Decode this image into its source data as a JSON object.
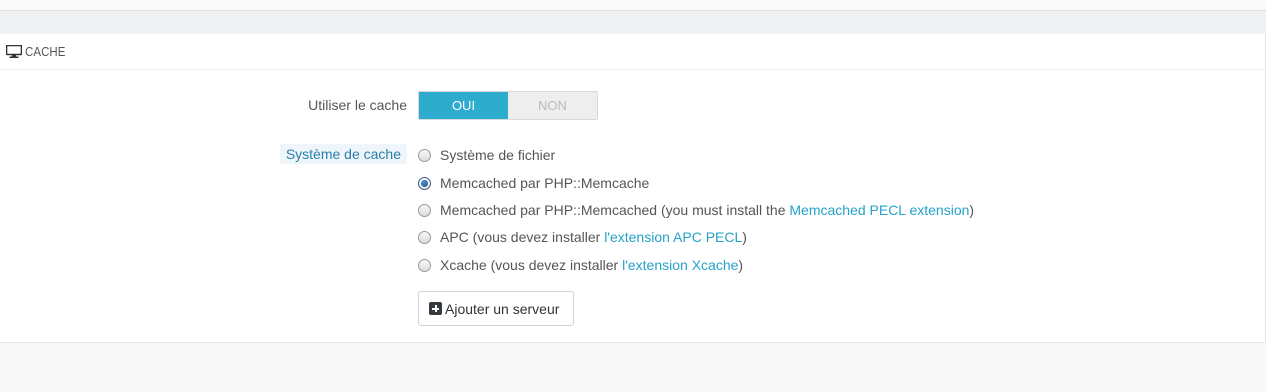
{
  "section": {
    "title": "CACHE",
    "icon": "desktop-icon"
  },
  "use_cache": {
    "label": "Utiliser le cache",
    "yes_label": "OUI",
    "no_label": "NON",
    "selected": "OUI"
  },
  "cache_system": {
    "label": "Système de cache",
    "options": [
      {
        "text": "Système de fichier",
        "checked": false
      },
      {
        "text": "Memcached par PHP::Memcache",
        "checked": true
      },
      {
        "text": "Memcached par PHP::Memcached (you must install the ",
        "link": "Memcached PECL extension",
        "suffix": ")",
        "checked": false
      },
      {
        "text": "APC (vous devez installer ",
        "link": "l'extension APC PECL",
        "suffix": ")",
        "checked": false
      },
      {
        "text": "Xcache (vous devez installer ",
        "link": "l'extension Xcache",
        "suffix": ")",
        "checked": false
      }
    ]
  },
  "add_server": {
    "label": "Ajouter un serveur",
    "icon": "plus-square-icon"
  },
  "colors": {
    "accent": "#2eacce",
    "link": "#25a2c9",
    "label_highlight_bg": "#eef6fb"
  }
}
